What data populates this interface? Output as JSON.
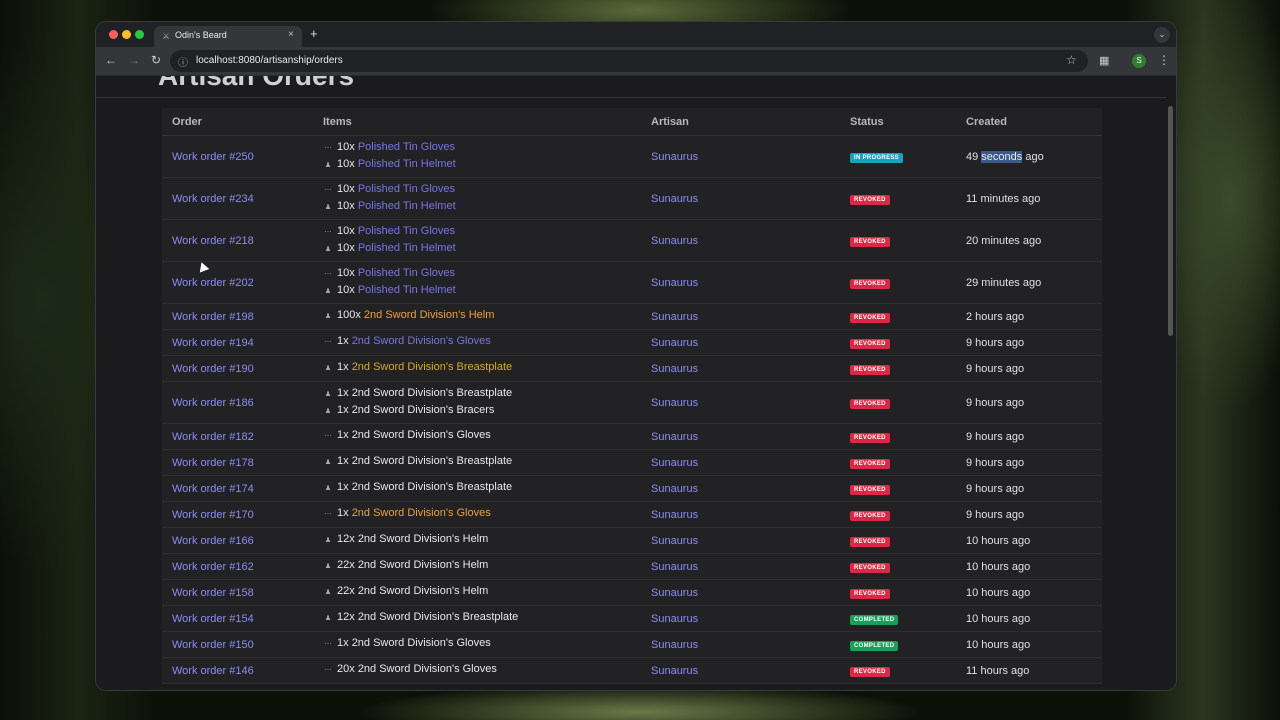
{
  "browser": {
    "tab_title": "Odin's Beard",
    "tab_close": "×",
    "new_tab": "+",
    "url": "localhost:8080/artisanship/orders",
    "profile_initial": "S"
  },
  "page": {
    "heading": "Artisan Orders"
  },
  "table": {
    "headers": {
      "order": "Order",
      "items": "Items",
      "artisan": "Artisan",
      "status": "Status",
      "created": "Created"
    },
    "rows": [
      {
        "order": "Work order #250",
        "items": [
          {
            "qty": "10x",
            "name": "Polished Tin Gloves",
            "color": "pur"
          },
          {
            "qty": "10x",
            "name": "Polished Tin Helmet",
            "color": "pur"
          }
        ],
        "artisan": "Sunaurus",
        "status": "IN PROGRESS",
        "created": "49 seconds ago"
      },
      {
        "order": "Work order #234",
        "items": [
          {
            "qty": "10x",
            "name": "Polished Tin Gloves",
            "color": "pur"
          },
          {
            "qty": "10x",
            "name": "Polished Tin Helmet",
            "color": "pur"
          }
        ],
        "artisan": "Sunaurus",
        "status": "REVOKED",
        "created": "11 minutes ago"
      },
      {
        "order": "Work order #218",
        "items": [
          {
            "qty": "10x",
            "name": "Polished Tin Gloves",
            "color": "pur"
          },
          {
            "qty": "10x",
            "name": "Polished Tin Helmet",
            "color": "pur"
          }
        ],
        "artisan": "Sunaurus",
        "status": "REVOKED",
        "created": "20 minutes ago"
      },
      {
        "order": "Work order #202",
        "items": [
          {
            "qty": "10x",
            "name": "Polished Tin Gloves",
            "color": "pur"
          },
          {
            "qty": "10x",
            "name": "Polished Tin Helmet",
            "color": "pur"
          }
        ],
        "artisan": "Sunaurus",
        "status": "REVOKED",
        "created": "29 minutes ago"
      },
      {
        "order": "Work order #198",
        "items": [
          {
            "qty": "100x",
            "name": "2nd Sword Division's Helm",
            "color": "ora"
          }
        ],
        "artisan": "Sunaurus",
        "status": "REVOKED",
        "created": "2 hours ago"
      },
      {
        "order": "Work order #194",
        "items": [
          {
            "qty": "1x",
            "name": "2nd Sword Division's Gloves",
            "color": "pur"
          }
        ],
        "artisan": "Sunaurus",
        "status": "REVOKED",
        "created": "9 hours ago"
      },
      {
        "order": "Work order #190",
        "items": [
          {
            "qty": "1x",
            "name": "2nd Sword Division's Breastplate",
            "color": "yel"
          }
        ],
        "artisan": "Sunaurus",
        "status": "REVOKED",
        "created": "9 hours ago"
      },
      {
        "order": "Work order #186",
        "items": [
          {
            "qty": "1x",
            "name": "2nd Sword Division's Breastplate",
            "color": "wht"
          },
          {
            "qty": "1x",
            "name": "2nd Sword Division's Bracers",
            "color": "wht"
          }
        ],
        "artisan": "Sunaurus",
        "status": "REVOKED",
        "created": "9 hours ago"
      },
      {
        "order": "Work order #182",
        "items": [
          {
            "qty": "1x",
            "name": "2nd Sword Division's Gloves",
            "color": "wht"
          }
        ],
        "artisan": "Sunaurus",
        "status": "REVOKED",
        "created": "9 hours ago"
      },
      {
        "order": "Work order #178",
        "items": [
          {
            "qty": "1x",
            "name": "2nd Sword Division's Breastplate",
            "color": "wht"
          }
        ],
        "artisan": "Sunaurus",
        "status": "REVOKED",
        "created": "9 hours ago"
      },
      {
        "order": "Work order #174",
        "items": [
          {
            "qty": "1x",
            "name": "2nd Sword Division's Breastplate",
            "color": "wht"
          }
        ],
        "artisan": "Sunaurus",
        "status": "REVOKED",
        "created": "9 hours ago"
      },
      {
        "order": "Work order #170",
        "items": [
          {
            "qty": "1x",
            "name": "2nd Sword Division's Gloves",
            "color": "ora"
          }
        ],
        "artisan": "Sunaurus",
        "status": "REVOKED",
        "created": "9 hours ago"
      },
      {
        "order": "Work order #166",
        "items": [
          {
            "qty": "12x",
            "name": "2nd Sword Division's Helm",
            "color": "wht"
          }
        ],
        "artisan": "Sunaurus",
        "status": "REVOKED",
        "created": "10 hours ago"
      },
      {
        "order": "Work order #162",
        "items": [
          {
            "qty": "22x",
            "name": "2nd Sword Division's Helm",
            "color": "wht"
          }
        ],
        "artisan": "Sunaurus",
        "status": "REVOKED",
        "created": "10 hours ago"
      },
      {
        "order": "Work order #158",
        "items": [
          {
            "qty": "22x",
            "name": "2nd Sword Division's Helm",
            "color": "wht"
          }
        ],
        "artisan": "Sunaurus",
        "status": "REVOKED",
        "created": "10 hours ago"
      },
      {
        "order": "Work order #154",
        "items": [
          {
            "qty": "12x",
            "name": "2nd Sword Division's Breastplate",
            "color": "wht"
          }
        ],
        "artisan": "Sunaurus",
        "status": "COMPLETED",
        "created": "10 hours ago"
      },
      {
        "order": "Work order #150",
        "items": [
          {
            "qty": "1x",
            "name": "2nd Sword Division's Gloves",
            "color": "wht"
          }
        ],
        "artisan": "Sunaurus",
        "status": "COMPLETED",
        "created": "10 hours ago"
      },
      {
        "order": "Work order #146",
        "items": [
          {
            "qty": "20x",
            "name": "2nd Sword Division's Gloves",
            "color": "wht"
          }
        ],
        "artisan": "Sunaurus",
        "status": "REVOKED",
        "created": "11 hours ago"
      }
    ]
  },
  "colors": {
    "link": "#8c8cf4",
    "in_progress": "#1aa0c0",
    "revoked": "#dc2846",
    "completed": "#17a05a",
    "item_purple": "#7a73e6",
    "item_orange": "#eea040",
    "item_yellow": "#d9a830"
  }
}
